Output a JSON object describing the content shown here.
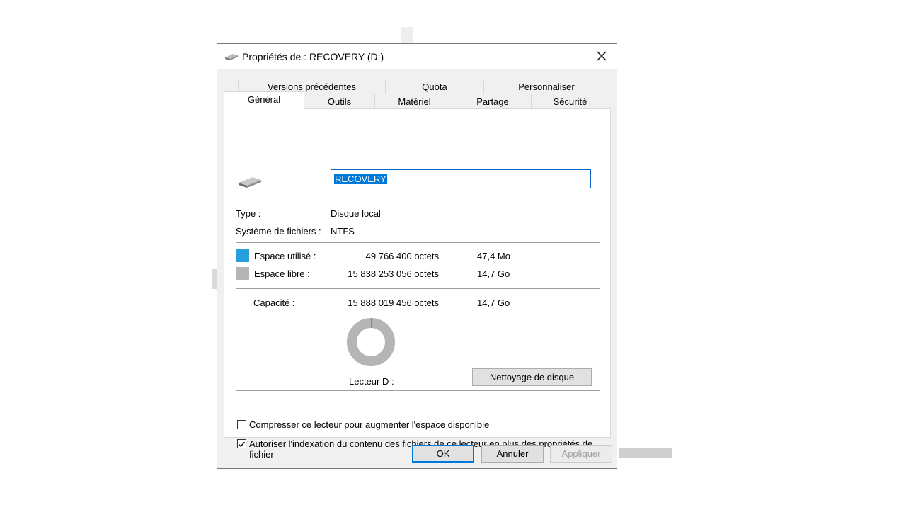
{
  "window": {
    "title": "Propriétés de : RECOVERY (D:)"
  },
  "tabs_top": [
    {
      "label": "Versions précédentes"
    },
    {
      "label": "Quota"
    },
    {
      "label": "Personnaliser"
    }
  ],
  "tabs_bottom": [
    {
      "label": "Général"
    },
    {
      "label": "Outils"
    },
    {
      "label": "Matériel"
    },
    {
      "label": "Partage"
    },
    {
      "label": "Sécurité"
    }
  ],
  "general": {
    "name_value": "RECOVERY",
    "type_label": "Type :",
    "type_value": "Disque local",
    "fs_label": "Système de fichiers :",
    "fs_value": "NTFS",
    "used_label": "Espace utilisé :",
    "used_bytes": "49 766 400 octets",
    "used_human": "47,4 Mo",
    "free_label": "Espace libre :",
    "free_bytes": "15 838 253 056 octets",
    "free_human": "14,7 Go",
    "capacity_label": "Capacité :",
    "capacity_bytes": "15 888 019 456 octets",
    "capacity_human": "14,7 Go",
    "drive_label": "Lecteur D :",
    "cleanup_button": "Nettoyage de disque",
    "used_fraction": 0.0031,
    "compress_label": "Compresser ce lecteur pour augmenter l'espace disponible",
    "compress_checked": false,
    "index_label": "Autoriser l'indexation du contenu des fichiers de ce lecteur en plus des propriétés de fichier",
    "index_checked": true
  },
  "colors": {
    "used": "#26a0da",
    "free": "#b5b5b5",
    "accent": "#0078d7"
  },
  "buttons": {
    "ok": "OK",
    "cancel": "Annuler",
    "apply": "Appliquer"
  }
}
